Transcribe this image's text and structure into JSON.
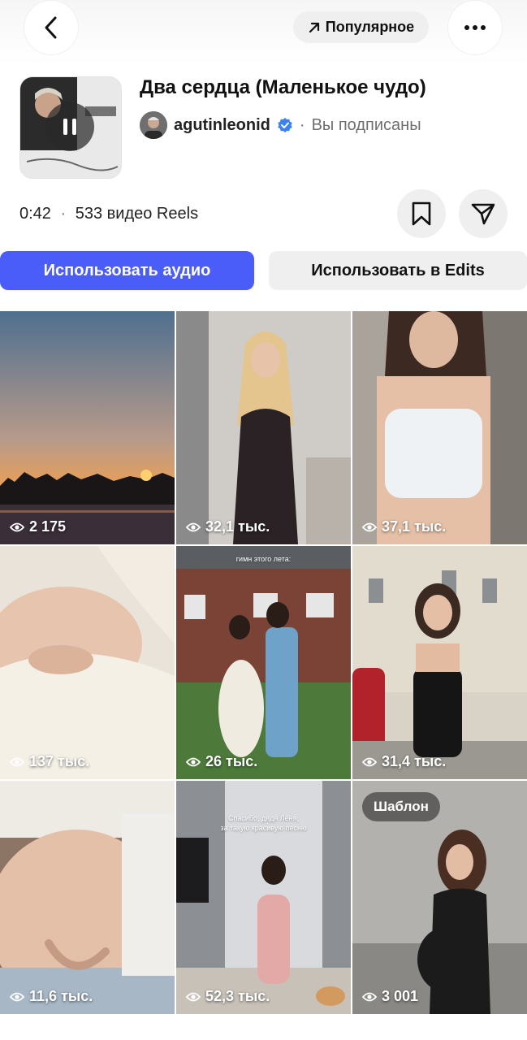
{
  "header": {
    "popular_label": "Популярное"
  },
  "audio": {
    "title": "Два сердца (Маленькое чудо)",
    "artist": "agutinleonid",
    "subscription_status": "Вы подписаны",
    "duration": "0:42",
    "reels_count": "533 видео Reels",
    "separator": "·"
  },
  "buttons": {
    "use_audio": "Использовать аудио",
    "use_in_edits": "Использовать в Edits"
  },
  "icons": {
    "back": "chevron-left-icon",
    "more": "more-icon",
    "popular": "arrow-up-right-icon",
    "pause": "pause-icon",
    "verified": "verified-badge-icon",
    "save": "bookmark-icon",
    "share": "send-icon",
    "views": "eye-icon"
  },
  "colors": {
    "accent": "#4a5df9",
    "verified": "#3b82f6"
  },
  "reels": [
    {
      "views": "2 175"
    },
    {
      "views": "32,1 тыс."
    },
    {
      "views": "37,1 тыс."
    },
    {
      "views": "137 тыс."
    },
    {
      "views": "26 тыс.",
      "overlay": "гимн этого лета:"
    },
    {
      "views": "31,4 тыс."
    },
    {
      "views": "11,6 тыс."
    },
    {
      "views": "52,3 тыс.",
      "overlay": "Спасибо, дядя Лёня,\nза такую красивую песню"
    },
    {
      "views": "3 001",
      "badge": "Шаблон"
    }
  ]
}
